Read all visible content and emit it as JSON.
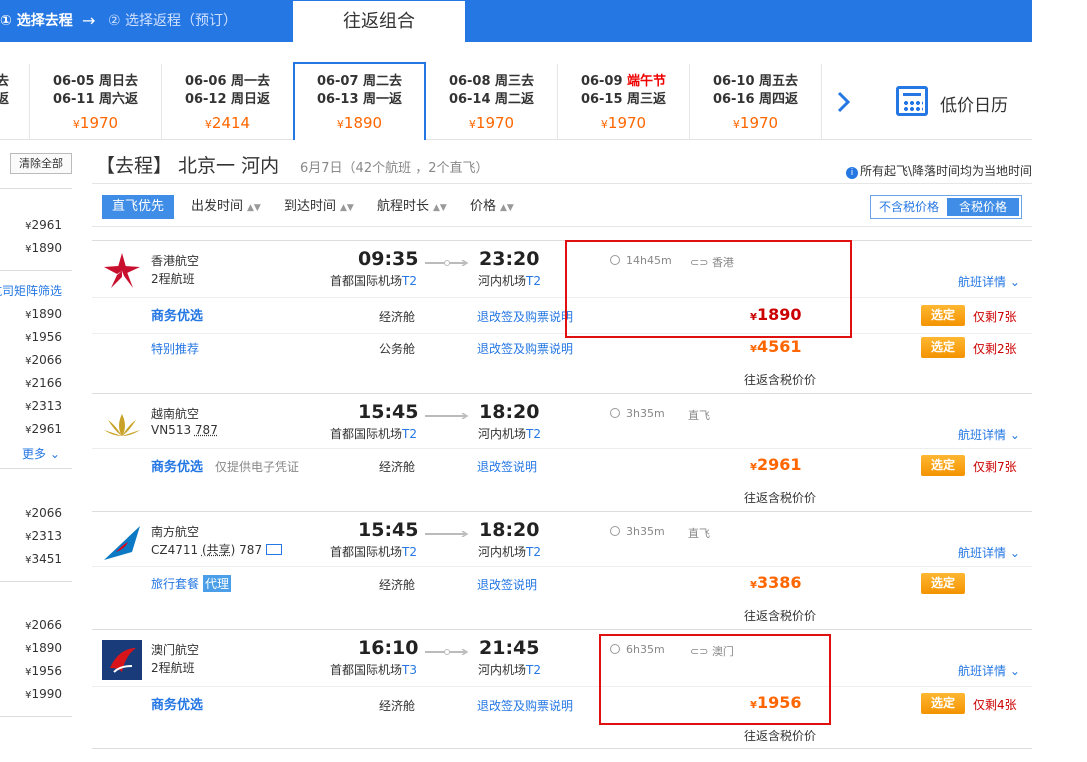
{
  "steps": {
    "step1": "① 选择去程",
    "arrow": "→",
    "step2": "② 选择返程（预订）",
    "combo_tab": "往返组合"
  },
  "date_strip": [
    {
      "l1": "06-05 周日去",
      "l2": "06-11 周六返",
      "price": "1970",
      "active": false
    },
    {
      "l1": "06-06 周一去",
      "l2": "06-12 周日返",
      "price": "2414",
      "active": false
    },
    {
      "l1": "06-07 周二去",
      "l2": "06-13 周一返",
      "price": "1890",
      "active": true
    },
    {
      "l1": "06-08 周三去",
      "l2": "06-14 周二返",
      "price": "1970",
      "active": false
    },
    {
      "l1a": "06-09 ",
      "holiday": "端午节",
      "l2": "06-15 周三返",
      "price": "1970",
      "active": false
    },
    {
      "l1": "06-10 周五去",
      "l2": "06-16 周四返",
      "price": "1970",
      "active": false
    }
  ],
  "currency": "¥",
  "next_icon": "chevron-right-icon",
  "calendar_label": "低价日历",
  "sidebar": {
    "clear_all": "清除全部",
    "group1": [
      "2961",
      "1890"
    ],
    "matrix_filter": "航司矩阵筛选",
    "group2": [
      "1890",
      "1956",
      "2066",
      "2166",
      "2313",
      "2961"
    ],
    "more": "更多",
    "group3": [
      "2066",
      "2313",
      "3451"
    ],
    "group4": [
      "2066",
      "1890",
      "1956",
      "1990"
    ]
  },
  "header": {
    "route": "【去程】 北京一 河内",
    "meta": "6月7日（42个航班 ，2个直飞）",
    "tz_note": "所有起飞\\降落时间均为当地时间"
  },
  "sort": {
    "direct_first": "直飞优先",
    "dep_time": "出发时间",
    "arr_time": "到达时间",
    "duration": "航程时长",
    "price": "价格",
    "tax_off": "不含税价格",
    "tax_on": "含税价格"
  },
  "labels": {
    "details": "航班详情",
    "select": "选定",
    "tax_incl": "往返含税价价",
    "brand_biz": "商务优选",
    "brand_special": "特别推荐",
    "brand_travel": "旅行套餐",
    "agent": "代理",
    "e_cert": "仅提供电子凭证",
    "economy": "经济舱",
    "business": "公务舱",
    "rules_buy": "退改签及购票说明",
    "rules": "退改签说明"
  },
  "flights": [
    {
      "airline": "香港航空",
      "fno": "2程航班",
      "aircraft": "",
      "dep": "09:35",
      "dep_ap": "首都国际机场",
      "dep_t": "T2",
      "arr": "23:20",
      "arr_ap": "河内机场",
      "arr_t": "T2",
      "duration": "14h45m",
      "stop": "香港",
      "fares": [
        {
          "price": "1890",
          "remain": "仅剩7张"
        },
        {
          "price": "4561",
          "remain": "仅剩2张"
        }
      ]
    },
    {
      "airline": "越南航空",
      "fno": "VN513",
      "aircraft": "787",
      "dep": "15:45",
      "dep_ap": "首都国际机场",
      "dep_t": "T2",
      "arr": "18:20",
      "arr_ap": "河内机场",
      "arr_t": "T2",
      "duration": "3h35m",
      "stop": "直飞",
      "fares": [
        {
          "price": "2961",
          "remain": "仅剩7张"
        }
      ]
    },
    {
      "airline": "南方航空",
      "fno": "CZ4711",
      "share": "(共享)",
      "aircraft": "787",
      "dep": "15:45",
      "dep_ap": "首都国际机场",
      "dep_t": "T2",
      "arr": "18:20",
      "arr_ap": "河内机场",
      "arr_t": "T2",
      "duration": "3h35m",
      "stop": "直飞",
      "fares": [
        {
          "price": "3386",
          "remain": ""
        }
      ]
    },
    {
      "airline": "澳门航空",
      "fno": "2程航班",
      "aircraft": "",
      "dep": "16:10",
      "dep_ap": "首都国际机场",
      "dep_t": "T3",
      "arr": "21:45",
      "arr_ap": "河内机场",
      "arr_t": "T2",
      "duration": "6h35m",
      "stop": "澳门",
      "fares": [
        {
          "price": "1956",
          "remain": "仅剩4张"
        }
      ]
    }
  ],
  "colors": {
    "accent": "#2577e3",
    "price": "#ff6600",
    "highlight": "#e01010"
  }
}
